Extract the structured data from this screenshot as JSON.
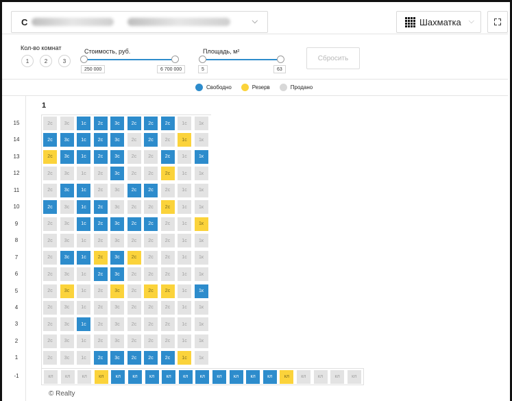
{
  "topbar": {
    "project_initial": "С",
    "view_label": "Шахматка",
    "chevron": "⌵"
  },
  "filters": {
    "rooms_label": "Кол-во комнат",
    "rooms": [
      "1",
      "2",
      "3"
    ],
    "price_label": "Стоимость, руб.",
    "price_min": "250 000",
    "price_max": "6 700 000",
    "area_label": "Площадь, м²",
    "area_min": "5",
    "area_max": "63",
    "reset_label": "Сбросить"
  },
  "legend": [
    {
      "label": "Свободно",
      "color": "#2d8ccc"
    },
    {
      "label": "Резерв",
      "color": "#fbd33b"
    },
    {
      "label": "Продано",
      "color": "#d8d8d8"
    }
  ],
  "board": {
    "section": "1",
    "floors": [
      {
        "floor": "15",
        "cells": [
          [
            "2с",
            "s"
          ],
          [
            "3с",
            "s"
          ],
          [
            "1с",
            "f"
          ],
          [
            "2с",
            "f"
          ],
          [
            "3с",
            "f"
          ],
          [
            "2с",
            "f"
          ],
          [
            "2с",
            "f"
          ],
          [
            "2с",
            "f"
          ],
          [
            "1с",
            "s"
          ],
          [
            "1к",
            "s"
          ]
        ]
      },
      {
        "floor": "14",
        "cells": [
          [
            "2с",
            "f"
          ],
          [
            "3с",
            "f"
          ],
          [
            "1с",
            "f"
          ],
          [
            "2с",
            "f"
          ],
          [
            "3с",
            "f"
          ],
          [
            "2с",
            "s"
          ],
          [
            "2с",
            "f"
          ],
          [
            "2с",
            "s"
          ],
          [
            "1с",
            "r"
          ],
          [
            "1к",
            "s"
          ]
        ]
      },
      {
        "floor": "13",
        "cells": [
          [
            "2с",
            "r"
          ],
          [
            "3с",
            "f"
          ],
          [
            "1с",
            "f"
          ],
          [
            "2с",
            "f"
          ],
          [
            "3с",
            "f"
          ],
          [
            "2с",
            "s"
          ],
          [
            "2с",
            "s"
          ],
          [
            "2с",
            "f"
          ],
          [
            "1с",
            "s"
          ],
          [
            "1к",
            "f"
          ]
        ]
      },
      {
        "floor": "12",
        "cells": [
          [
            "2с",
            "s"
          ],
          [
            "3с",
            "s"
          ],
          [
            "1с",
            "s"
          ],
          [
            "2с",
            "s"
          ],
          [
            "3с",
            "f"
          ],
          [
            "2с",
            "s"
          ],
          [
            "2с",
            "s"
          ],
          [
            "2с",
            "r"
          ],
          [
            "1с",
            "s"
          ],
          [
            "1к",
            "s"
          ]
        ]
      },
      {
        "floor": "11",
        "cells": [
          [
            "2с",
            "s"
          ],
          [
            "3с",
            "f"
          ],
          [
            "1с",
            "f"
          ],
          [
            "2с",
            "s"
          ],
          [
            "3с",
            "s"
          ],
          [
            "2с",
            "f"
          ],
          [
            "2с",
            "f"
          ],
          [
            "2с",
            "s"
          ],
          [
            "1с",
            "s"
          ],
          [
            "1к",
            "s"
          ]
        ]
      },
      {
        "floor": "10",
        "cells": [
          [
            "2с",
            "f"
          ],
          [
            "3с",
            "s"
          ],
          [
            "1с",
            "f"
          ],
          [
            "2с",
            "f"
          ],
          [
            "3с",
            "s"
          ],
          [
            "2с",
            "s"
          ],
          [
            "2с",
            "s"
          ],
          [
            "2с",
            "r"
          ],
          [
            "1с",
            "s"
          ],
          [
            "1к",
            "s"
          ]
        ]
      },
      {
        "floor": "9",
        "cells": [
          [
            "2с",
            "s"
          ],
          [
            "3с",
            "s"
          ],
          [
            "1с",
            "f"
          ],
          [
            "2с",
            "f"
          ],
          [
            "3с",
            "f"
          ],
          [
            "2с",
            "f"
          ],
          [
            "2с",
            "f"
          ],
          [
            "2с",
            "s"
          ],
          [
            "1с",
            "s"
          ],
          [
            "1к",
            "r"
          ]
        ]
      },
      {
        "floor": "8",
        "cells": [
          [
            "2с",
            "s"
          ],
          [
            "3с",
            "s"
          ],
          [
            "1с",
            "s"
          ],
          [
            "2с",
            "s"
          ],
          [
            "3с",
            "s"
          ],
          [
            "2с",
            "s"
          ],
          [
            "2с",
            "s"
          ],
          [
            "2с",
            "s"
          ],
          [
            "1с",
            "s"
          ],
          [
            "1к",
            "s"
          ]
        ]
      },
      {
        "floor": "7",
        "cells": [
          [
            "2с",
            "s"
          ],
          [
            "3с",
            "f"
          ],
          [
            "1с",
            "f"
          ],
          [
            "2с",
            "r"
          ],
          [
            "3с",
            "f"
          ],
          [
            "2с",
            "r"
          ],
          [
            "2с",
            "s"
          ],
          [
            "2с",
            "s"
          ],
          [
            "1с",
            "s"
          ],
          [
            "1к",
            "s"
          ]
        ]
      },
      {
        "floor": "6",
        "cells": [
          [
            "2с",
            "s"
          ],
          [
            "3с",
            "s"
          ],
          [
            "1с",
            "s"
          ],
          [
            "2с",
            "f"
          ],
          [
            "3с",
            "f"
          ],
          [
            "2с",
            "s"
          ],
          [
            "2с",
            "s"
          ],
          [
            "2с",
            "s"
          ],
          [
            "1с",
            "s"
          ],
          [
            "1к",
            "s"
          ]
        ]
      },
      {
        "floor": "5",
        "cells": [
          [
            "2с",
            "s"
          ],
          [
            "3с",
            "r"
          ],
          [
            "1с",
            "s"
          ],
          [
            "2с",
            "s"
          ],
          [
            "3с",
            "r"
          ],
          [
            "2с",
            "s"
          ],
          [
            "2с",
            "r"
          ],
          [
            "2с",
            "r"
          ],
          [
            "1с",
            "s"
          ],
          [
            "1к",
            "f"
          ]
        ]
      },
      {
        "floor": "4",
        "cells": [
          [
            "2с",
            "s"
          ],
          [
            "3с",
            "s"
          ],
          [
            "1с",
            "s"
          ],
          [
            "2с",
            "s"
          ],
          [
            "3с",
            "s"
          ],
          [
            "2с",
            "s"
          ],
          [
            "2с",
            "s"
          ],
          [
            "2с",
            "s"
          ],
          [
            "1с",
            "s"
          ],
          [
            "1к",
            "s"
          ]
        ]
      },
      {
        "floor": "3",
        "cells": [
          [
            "2с",
            "s"
          ],
          [
            "3с",
            "s"
          ],
          [
            "1с",
            "f"
          ],
          [
            "2с",
            "s"
          ],
          [
            "3с",
            "s"
          ],
          [
            "2с",
            "s"
          ],
          [
            "2с",
            "s"
          ],
          [
            "2с",
            "s"
          ],
          [
            "1с",
            "s"
          ],
          [
            "1к",
            "s"
          ]
        ]
      },
      {
        "floor": "2",
        "cells": [
          [
            "2с",
            "s"
          ],
          [
            "3с",
            "s"
          ],
          [
            "1с",
            "s"
          ],
          [
            "2с",
            "s"
          ],
          [
            "3с",
            "s"
          ],
          [
            "2с",
            "s"
          ],
          [
            "2с",
            "s"
          ],
          [
            "2с",
            "s"
          ],
          [
            "1с",
            "s"
          ],
          [
            "1к",
            "s"
          ]
        ]
      },
      {
        "floor": "1",
        "cells": [
          [
            "2с",
            "s"
          ],
          [
            "3с",
            "s"
          ],
          [
            "1с",
            "s"
          ],
          [
            "2с",
            "f"
          ],
          [
            "3с",
            "f"
          ],
          [
            "2с",
            "f"
          ],
          [
            "2с",
            "f"
          ],
          [
            "2с",
            "f"
          ],
          [
            "1с",
            "r"
          ],
          [
            "1к",
            "s"
          ]
        ]
      }
    ],
    "basement": {
      "floor": "-1",
      "cells": [
        [
          "кл",
          "s"
        ],
        [
          "кл",
          "s"
        ],
        [
          "кл",
          "s"
        ],
        [
          "кл",
          "r"
        ],
        [
          "кл",
          "f"
        ],
        [
          "кл",
          "f"
        ],
        [
          "кл",
          "f"
        ],
        [
          "кл",
          "f"
        ],
        [
          "кл",
          "f"
        ],
        [
          "кл",
          "f"
        ],
        [
          "кл",
          "f"
        ],
        [
          "кл",
          "f"
        ],
        [
          "кл",
          "f"
        ],
        [
          "кл",
          "f"
        ],
        [
          "кл",
          "r"
        ],
        [
          "кл",
          "s"
        ],
        [
          "кл",
          "s"
        ],
        [
          "кл",
          "s"
        ],
        [
          "кл",
          "s"
        ]
      ]
    }
  },
  "footer": {
    "copyright": "© Realty"
  }
}
